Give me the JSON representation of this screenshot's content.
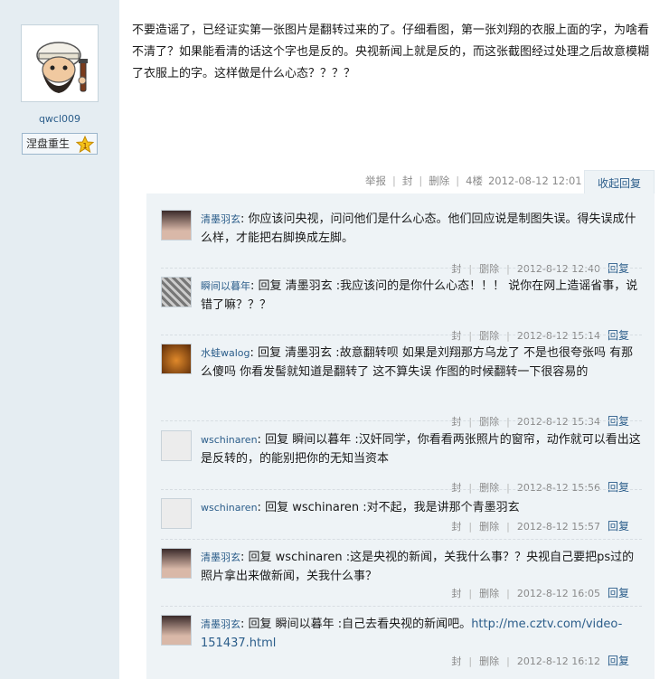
{
  "author": {
    "name": "qwcl009",
    "medal_label": "涅盘重生",
    "medal_level": "1"
  },
  "post": {
    "text": "不要造谣了，已经证实第一张图片是翻转过来的了。仔细看图，第一张刘翔的衣服上面的字，为啥看不清了？如果能看清的话这个字也是反的。央视新闻上就是反的，而这张截图经过处理之后故意模糊了衣服上的字。这样做是什么心态？？？？"
  },
  "floor": {
    "report": "举报",
    "block": "封",
    "delete": "删除",
    "floor_label": "4楼",
    "time": "2012-08-12 12:01",
    "collapse_label": "收起回复"
  },
  "replies": [
    {
      "user": "清墨羽玄",
      "colon": ":",
      "text": "你应该问央视，问问他们是什么心态。他们回应说是制图失误。得失误成什么样，才能把右脚换成左脚。",
      "block": "封",
      "delete": "删除",
      "time": "2012-8-12 12:40",
      "reply_label": "回复"
    },
    {
      "user": "瞬间以暮年",
      "colon": ":",
      "text": "回复  清墨羽玄 :我应该问的是你什么心态！！！  说你在网上造谣省事，说错了嘛？？？",
      "block": "封",
      "delete": "删除",
      "time": "2012-8-12 15:14",
      "reply_label": "回复"
    },
    {
      "user": "水蛙walog",
      "colon": ":",
      "text": "回复  清墨羽玄 :故意翻转呗  如果是刘翔那方乌龙了  不是也很夸张吗  有那么傻吗  你看发髻就知道是翻转了  这不算失误  作图的时候翻转一下很容易的",
      "block": "封",
      "delete": "删除",
      "time": "2012-8-12 15:34",
      "reply_label": "回复"
    },
    {
      "user": "wschinaren",
      "colon": ":",
      "text": "回复  瞬间以暮年 :汉奸同学，你看看两张照片的窗帘，动作就可以看出这是反转的，的能别把你的无知当资本",
      "block": "封",
      "delete": "删除",
      "time": "2012-8-12 15:56",
      "reply_label": "回复"
    },
    {
      "user": "wschinaren",
      "colon": ":",
      "text": "回复  wschinaren :对不起，我是讲那个青墨羽玄",
      "block": "封",
      "delete": "删除",
      "time": "2012-8-12 15:57",
      "reply_label": "回复"
    },
    {
      "user": "清墨羽玄",
      "colon": ":",
      "text": "回复  wschinaren :这是央视的新闻，关我什么事？？央视自己要把ps过的照片拿出来做新闻，关我什么事？",
      "block": "封",
      "delete": "删除",
      "time": "2012-8-12 16:05",
      "reply_label": "回复"
    },
    {
      "user": "清墨羽玄",
      "colon": ":",
      "text": "回复  瞬间以暮年 :自己去看央视的新闻吧。",
      "link": "http://me.cztv.com/video-151437.html",
      "block": "封",
      "delete": "删除",
      "time": "2012-8-12 16:12",
      "reply_label": "回复"
    }
  ],
  "colors": {
    "link": "#2b5d8a",
    "sidebar": "#e5edf2",
    "reply_bg": "#eef3f6",
    "meta": "#8a8a8a"
  }
}
